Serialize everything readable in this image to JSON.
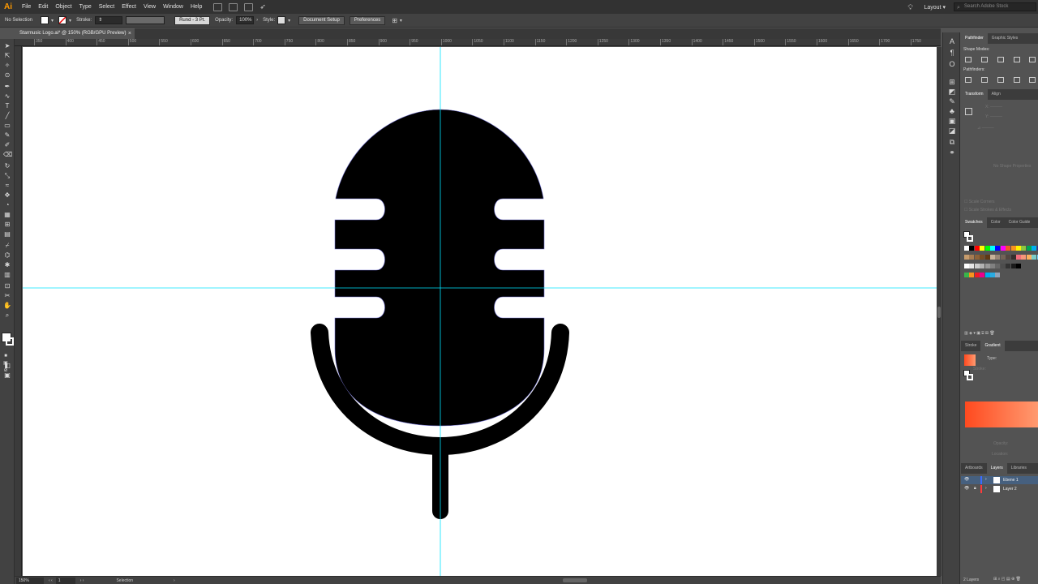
{
  "app": {
    "logo": "Ai",
    "menus": [
      "File",
      "Edit",
      "Object",
      "Type",
      "Select",
      "Effect",
      "View",
      "Window",
      "Help"
    ],
    "workspace": "Layout",
    "search_placeholder": "Search Adobe Stock"
  },
  "control_bar": {
    "selection_label": "No Selection",
    "stroke_label": "Stroke:",
    "brush_label": "Rund - 3 Pt.",
    "opacity_label": "Opacity:",
    "opacity_value": "100%",
    "style_label": "Style:",
    "document_setup": "Document Setup",
    "preferences": "Preferences"
  },
  "document": {
    "tab_title": "Starmusic Logo.ai* @ 150% (RGB/GPU Preview)",
    "close": "×"
  },
  "ruler": {
    "labels": [
      "350",
      "400",
      "450",
      "500",
      "550",
      "600",
      "650",
      "700",
      "750",
      "800",
      "850",
      "900",
      "950",
      "1000",
      "1050",
      "1100",
      "1150",
      "1200",
      "1250",
      "1300",
      "1350",
      "1400",
      "1450",
      "1500",
      "1550",
      "1600",
      "1650",
      "1700",
      "1750"
    ]
  },
  "statusbar": {
    "zoom": "150%",
    "artboard": "1",
    "tool": "Selection"
  },
  "panels": {
    "top_tabs": [
      "Pathfinder",
      "Graphic Styles"
    ],
    "shape_modes": "Shape Modes:",
    "pathfinders": "Pathfinders:",
    "transform_tabs": [
      "Transform",
      "Align"
    ],
    "no_shape_properties": "No Shape Properties",
    "scale_corners": "Scale Corners",
    "scale_strokes": "Scale Strokes & Effects",
    "swatch_tabs": [
      "Swatches",
      "Color",
      "Color Guide"
    ],
    "stroke_gradient_tabs": [
      "Stroke",
      "Gradient"
    ],
    "gradient_type_label": "Type:",
    "gradient_stroke_label": "Stroke:",
    "opacity_label": "Opacity:",
    "location_label": "Location:",
    "layers_tabs": [
      "Artboards",
      "Layers",
      "Libraries"
    ],
    "layers": [
      "Ebene 1",
      "Layer 2"
    ],
    "layers_count": "2 Layers"
  },
  "colors": {
    "accent": "#ff9a00",
    "guide": "#00ffff",
    "gradient_start": "#ff4a1f",
    "gradient_end": "#ff9a70",
    "layer_selected": "#46607f"
  }
}
